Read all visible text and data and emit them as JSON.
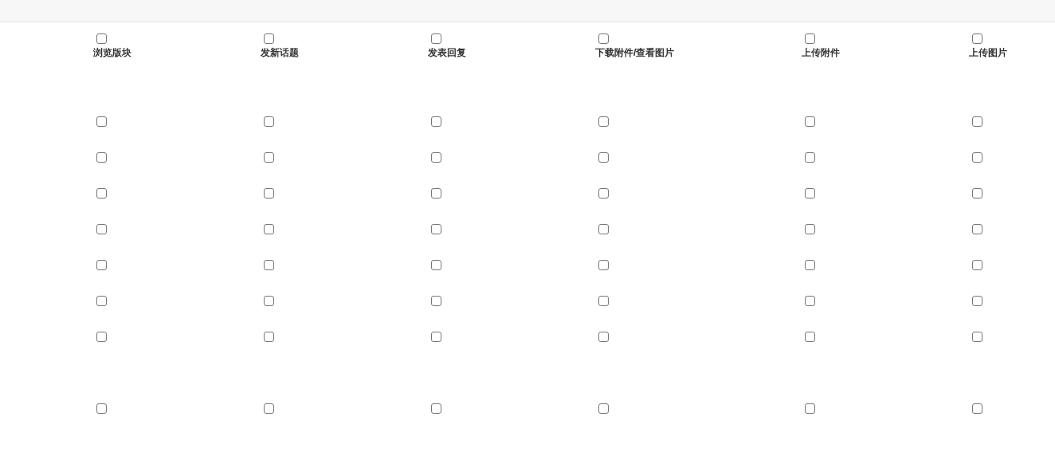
{
  "columns": [
    {
      "label": "浏览版块",
      "checked": false
    },
    {
      "label": "发新话题",
      "checked": false
    },
    {
      "label": "发表回复",
      "checked": false
    },
    {
      "label": "下载附件/查看图片",
      "checked": false
    },
    {
      "label": "上传附件",
      "checked": false
    },
    {
      "label": "上传图片",
      "checked": false
    }
  ],
  "rows": [
    {
      "checks": [
        false,
        false,
        false,
        false,
        false,
        false
      ]
    },
    {
      "checks": [
        false,
        false,
        false,
        false,
        false,
        false
      ]
    },
    {
      "checks": [
        false,
        false,
        false,
        false,
        false,
        false
      ]
    },
    {
      "checks": [
        false,
        false,
        false,
        false,
        false,
        false
      ]
    },
    {
      "checks": [
        false,
        false,
        false,
        false,
        false,
        false
      ]
    },
    {
      "checks": [
        false,
        false,
        false,
        false,
        false,
        false
      ]
    },
    {
      "checks": [
        false,
        false,
        false,
        false,
        false,
        false
      ]
    },
    {
      "checks": [
        false,
        false,
        false,
        false,
        false,
        false
      ]
    }
  ]
}
